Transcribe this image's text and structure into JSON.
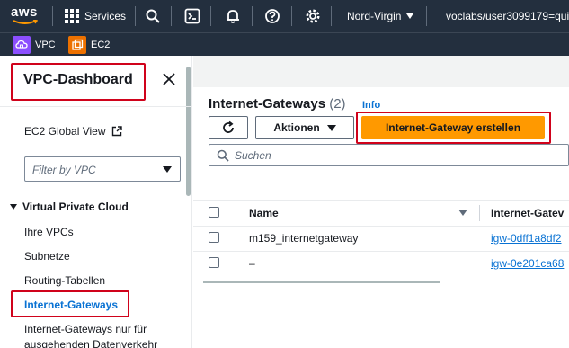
{
  "topnav": {
    "logo_text": "aws",
    "services_label": "Services",
    "region_label": "Nord-Virgin",
    "account_label": "voclabs/user3099179=quiri"
  },
  "favorites": [
    {
      "label": "VPC",
      "color": "#8c4fff"
    },
    {
      "label": "EC2",
      "color": "#ed7100"
    }
  ],
  "sidebar": {
    "title": "VPC-Dashboard",
    "global_view": "EC2 Global View",
    "filter_placeholder": "Filter by VPC",
    "section": "Virtual Private Cloud",
    "items": [
      "Ihre VPCs",
      "Subnetze",
      "Routing-Tabellen",
      "Internet-Gateways",
      "Internet-Gateways nur für",
      "ausgehenden Datenverkehr"
    ]
  },
  "main": {
    "title": "Internet-Gateways",
    "count": "(2)",
    "info": "Info",
    "actions_label": "Aktionen",
    "create_label": "Internet-Gateway erstellen",
    "search_placeholder": "Suchen",
    "columns": [
      "Name",
      "Internet-Gatev"
    ],
    "rows": [
      {
        "name": "m159_internetgateway",
        "id": "igw-0dff1a8df2"
      },
      {
        "name": "–",
        "id": "igw-0e201ca68"
      }
    ]
  },
  "colors": {
    "nav_bg": "#232f3e",
    "primary": "#ff9900",
    "link": "#0972d3",
    "highlight": "#d0021b"
  }
}
